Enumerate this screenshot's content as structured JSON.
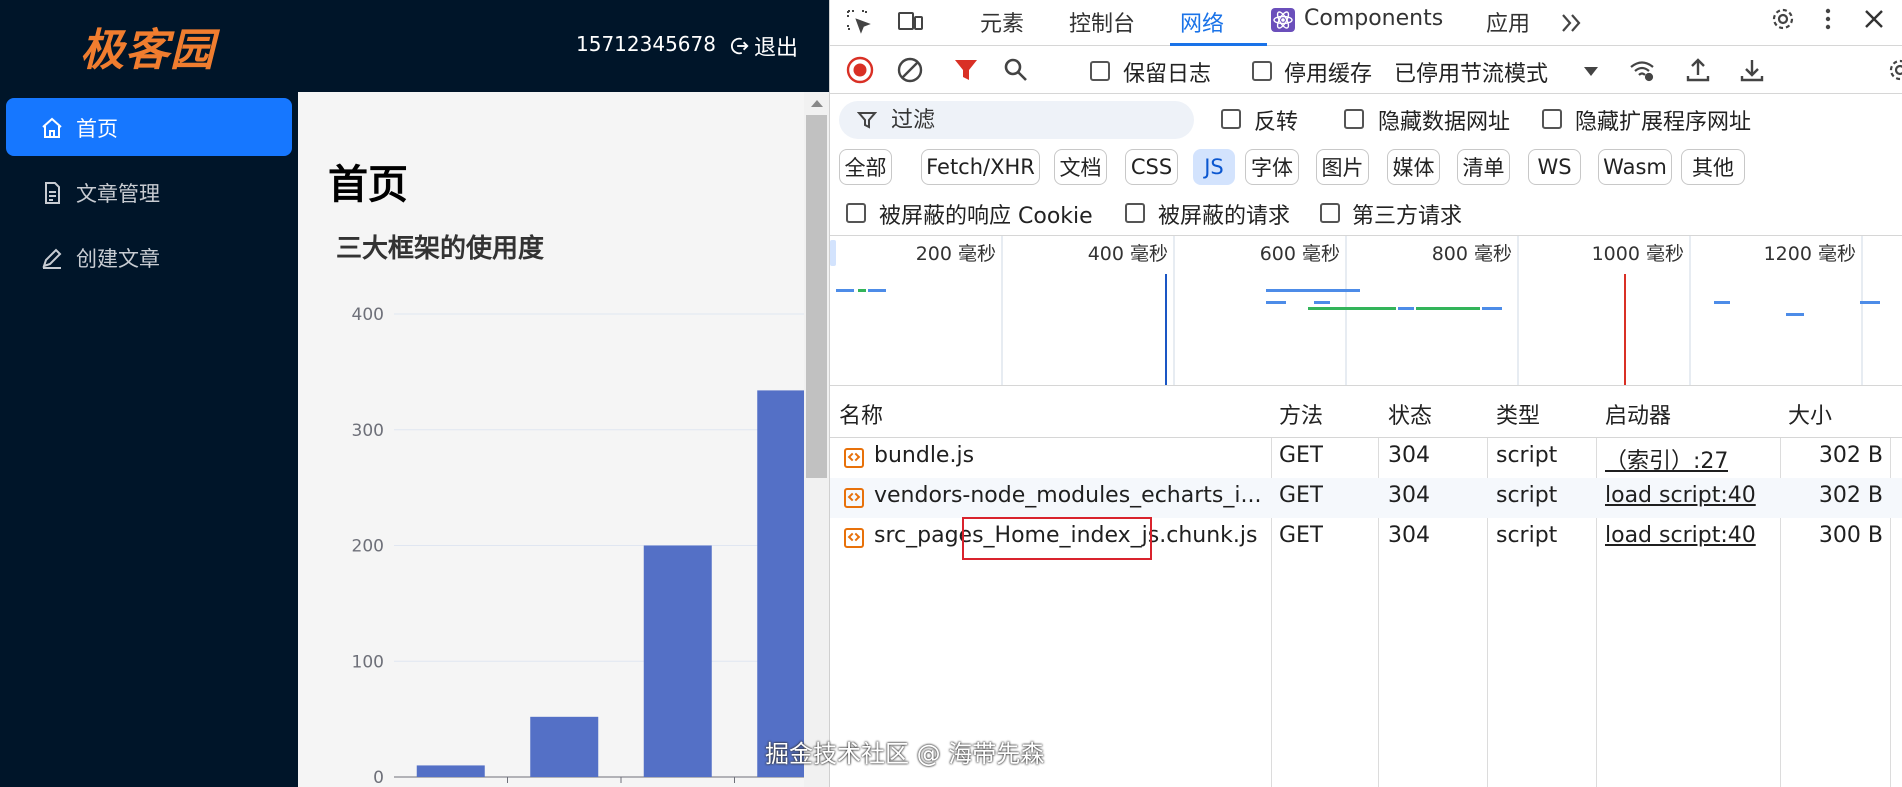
{
  "app": {
    "logo": "极客园",
    "user_phone": "15712345678",
    "logout_label": "退出",
    "sidebar": {
      "items": [
        {
          "label": "首页",
          "icon": "home-icon",
          "active": true
        },
        {
          "label": "文章管理",
          "icon": "document-icon",
          "active": false
        },
        {
          "label": "创建文章",
          "icon": "edit-icon",
          "active": false
        }
      ]
    },
    "page_title": "首页",
    "chart_title": "三大框架的使用度"
  },
  "chart_data": {
    "type": "bar",
    "title": "三大框架的使用度",
    "categories": [
      "",
      "",
      "",
      ""
    ],
    "values": [
      10,
      52,
      200,
      334
    ],
    "ylim": [
      0,
      400
    ],
    "yticks": [
      "0",
      "100",
      "200",
      "300",
      "400"
    ],
    "grid": true,
    "color": "#5470c6"
  },
  "devtools": {
    "tabs": [
      {
        "label": "元素",
        "active": false
      },
      {
        "label": "控制台",
        "active": false
      },
      {
        "label": "网络",
        "active": true
      },
      {
        "label": "Components",
        "active": false
      },
      {
        "label": "应用",
        "active": false
      }
    ],
    "toolbar": {
      "preserve_log": "保留日志",
      "disable_cache": "停用缓存",
      "throttling": "已停用节流模式"
    },
    "filter": {
      "placeholder": "过滤",
      "invert": "反转",
      "hide_data_urls": "隐藏数据网址",
      "hide_extension_urls": "隐藏扩展程序网址"
    },
    "types": [
      {
        "label": "全部",
        "active": false
      },
      {
        "label": "Fetch/XHR",
        "active": false
      },
      {
        "label": "文档",
        "active": false
      },
      {
        "label": "CSS",
        "active": false
      },
      {
        "label": "JS",
        "active": true
      },
      {
        "label": "字体",
        "active": false
      },
      {
        "label": "图片",
        "active": false
      },
      {
        "label": "媒体",
        "active": false
      },
      {
        "label": "清单",
        "active": false
      },
      {
        "label": "WS",
        "active": false
      },
      {
        "label": "Wasm",
        "active": false
      },
      {
        "label": "其他",
        "active": false
      }
    ],
    "extra_filters": {
      "blocked_cookies": "被屏蔽的响应 Cookie",
      "blocked_requests": "被屏蔽的请求",
      "third_party": "第三方请求"
    },
    "timeline_labels": [
      "200 毫秒",
      "400 毫秒",
      "600 毫秒",
      "800 毫秒",
      "1000 毫秒",
      "1200 毫秒"
    ],
    "columns": [
      "名称",
      "方法",
      "状态",
      "类型",
      "启动器",
      "大小"
    ],
    "rows": [
      {
        "name": "bundle.js",
        "method": "GET",
        "status": "304",
        "type": "script",
        "initiator": "（索引）:27",
        "size": "302 B"
      },
      {
        "name": "vendors-node_modules_echarts_i...",
        "method": "GET",
        "status": "304",
        "type": "script",
        "initiator": "load script:40",
        "size": "302 B"
      },
      {
        "name": "src_pages_Home_index_js.chunk.js",
        "method": "GET",
        "status": "304",
        "type": "script",
        "initiator": "load script:40",
        "size": "300 B"
      }
    ]
  },
  "watermark": "掘金技术社区 @ 海带先森"
}
